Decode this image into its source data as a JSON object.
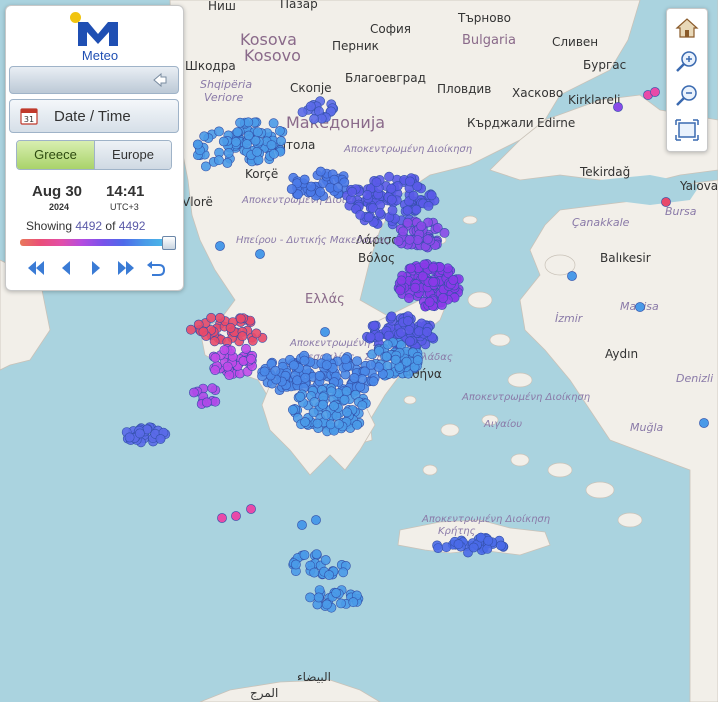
{
  "app": {
    "logo_text": "Meteo"
  },
  "panel": {
    "datetime_label": "Date / Time",
    "tabs": [
      {
        "label": "Greece",
        "active": true
      },
      {
        "label": "Europe",
        "active": false
      }
    ],
    "date": "Aug 30",
    "year": "2024",
    "time": "14:41",
    "timezone": "UTC+3",
    "showing_prefix": "Showing",
    "showing_count": "4492",
    "showing_mid": "of",
    "showing_total": "4492",
    "slider_position": 1.0,
    "playback_buttons": [
      "rewind-icon",
      "step-back-icon",
      "play-icon",
      "fast-forward-icon",
      "reset-icon"
    ]
  },
  "zoom_controls": [
    "home-icon",
    "zoom-in-icon",
    "zoom-out-icon",
    "fit-extent-icon"
  ],
  "colors": {
    "accent_green": "#a9d36a",
    "brand_blue": "#1f4fb3",
    "sea": "#aad3df",
    "land": "#f2efe9"
  },
  "map_labels": {
    "cities": [
      "Ниш",
      "Пазар",
      "Търново",
      "София",
      "Bulgaria",
      "Перник",
      "Kosova",
      "Kosovo",
      "Благоевград",
      "Пловдив",
      "Хасково",
      "Kirklareli",
      "Бургас",
      "Сливен",
      "Кърджали",
      "Edirne",
      "Шкодра",
      "Shqipëria",
      "Veriore",
      "Скопје",
      "Македонија",
      "Битола",
      "Korçë",
      "Tekirdağ",
      "Yalova",
      "Bursa",
      "Çanakkale",
      "Balıkesir",
      "Vlorë",
      "Ελλάς",
      "Λάρισα",
      "Βόλος",
      "İzmir",
      "Manisa",
      "Aydın",
      "Denizli",
      "Muğla",
      "Αθήνα",
      "المرج",
      "البيضاء"
    ],
    "regions": [
      "Ηπείρου - Δυτικής Μακεδονίας",
      "Αποκεντρωμένη Διοίκηση",
      "Θεσσαλίας - Στερεάς Ελλάδας",
      "Αιγαίου",
      "Κρήτης"
    ]
  }
}
